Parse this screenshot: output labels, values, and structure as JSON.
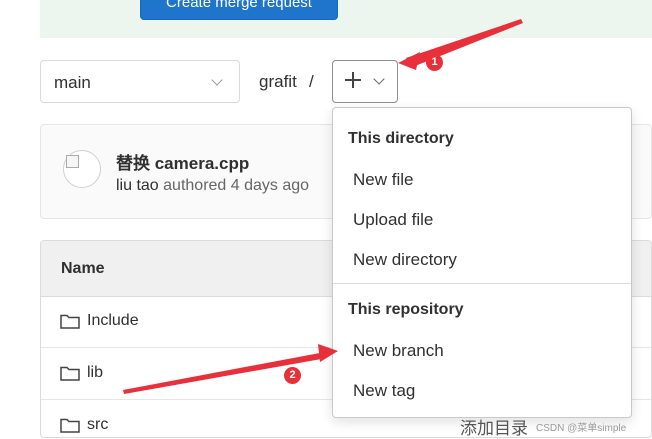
{
  "header": {
    "primary_button": "Create merge request"
  },
  "repo_nav": {
    "branch": "main",
    "path_segment": "grafit",
    "path_separator": "/"
  },
  "commit": {
    "title": "替换 camera.cpp",
    "author": "liu tao",
    "meta": "authored 4 days ago"
  },
  "table": {
    "header_name": "Name",
    "rows": [
      {
        "name": "Include",
        "icon": "folder-icon"
      },
      {
        "name": "lib",
        "icon": "folder-icon"
      },
      {
        "name": "src",
        "icon": "folder-icon"
      }
    ]
  },
  "dropdown": {
    "section1": "This directory",
    "items1": [
      "New file",
      "Upload file",
      "New directory"
    ],
    "section2": "This repository",
    "items2": [
      "New branch",
      "New tag"
    ]
  },
  "annotations": {
    "marker1": "1",
    "marker2": "2"
  },
  "overlay_text": {
    "caption": "添加目录",
    "watermark": "CSDN @菜单simple"
  },
  "colors": {
    "primary": "#1f75cb",
    "banner_bg": "#edf6ee",
    "annotation_red": "#e8303a"
  }
}
